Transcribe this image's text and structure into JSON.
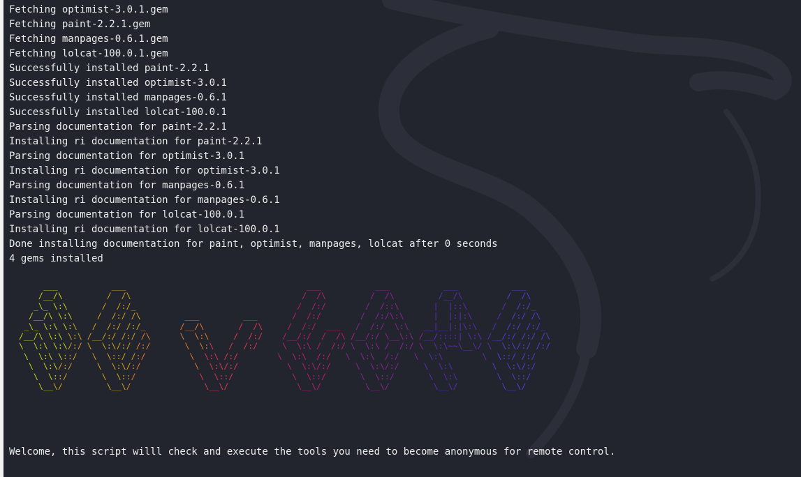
{
  "terminal": {
    "output_lines": [
      "Fetching optimist-3.0.1.gem",
      "Fetching paint-2.2.1.gem",
      "Fetching manpages-0.6.1.gem",
      "Fetching lolcat-100.0.1.gem",
      "Successfully installed paint-2.2.1",
      "Successfully installed optimist-3.0.1",
      "Successfully installed manpages-0.6.1",
      "Successfully installed lolcat-100.0.1",
      "Parsing documentation for paint-2.2.1",
      "Installing ri documentation for paint-2.2.1",
      "Parsing documentation for optimist-3.0.1",
      "Installing ri documentation for optimist-3.0.1",
      "Parsing documentation for manpages-0.6.1",
      "Installing ri documentation for manpages-0.6.1",
      "Parsing documentation for lolcat-100.0.1",
      "Installing ri documentation for lolcat-100.0.1",
      "Done installing documentation for paint, optimist, manpages, lolcat after 0 seconds",
      "4 gems installed"
    ],
    "banner_lines": [
      "       ___           ___                                     ___           ___           ___           ___",
      "      /__/\\         /  /\\                                   /  /\\         /  /\\         /__/\\         /  /\\",
      "     _\\_ \\:\\       /  /:/_                                 /  /:/        /  /::\\       |  |::\\       /  /:/_",
      "    /__/\\ \\:\\     /  /:/ /\\         ___         ___       /  /:/        /  /:/\\:\\      |  |:|:\\     /  /:/ /\\",
      "   _\\_ \\:\\ \\:\\   /  /:/ /:/_       /__/\\       /  /\\     /  /:/  ___   /  /:/  \\:\\   __|__|:|\\:\\   /  /:/ /:/_",
      "  /__/\\ \\:\\ \\:\\ /__/:/ /:/ /\\      \\  \\:\\     /  /:/    /__/:/  /  /\\ /__/:/ \\__\\:\\ /__/::::| \\:\\ /__/:/ /:/ /\\",
      "  \\  \\:\\ \\:\\/:/ \\  \\:\\/:/ /:/       \\  \\:\\   /  /:/     \\  \\:\\ /  /:/ \\  \\:\\ /  /:/ \\  \\:\\~~\\__\\/ \\  \\:\\/:/ /:/",
      "   \\  \\:\\ \\::/   \\  \\::/ /:/         \\  \\:\\ /:/        \\  \\:\\  /:/   \\  \\:\\  /:/   \\  \\:\\        \\  \\::/ /:/",
      "    \\  \\:\\/:/     \\  \\:\\/:/           \\  \\:\\/:/          \\  \\:\\/:/     \\  \\:\\/:/     \\  \\:\\        \\  \\:\\/:/",
      "     \\  \\::/       \\  \\::/             \\  \\::/            \\  \\::/       \\  \\::/       \\  \\:\\        \\  \\::/",
      "      \\__\\/         \\__\\/               \\__\\/              \\__\\/         \\__\\/         \\__\\/         \\__\\/"
    ],
    "banner_colors": [
      "#c7cf1c",
      "#d2a21d",
      "#e57a2a",
      "#e2364f",
      "#b81e74",
      "#8c2397",
      "#5b2cb8",
      "#4d40d3"
    ],
    "welcome_text": "Welcome, this script willl check and execute the tools you need to become anonymous for remote control.",
    "background_color": "#23252e",
    "text_color": "#ebebeb",
    "background_logo": "kali-dragon-icon"
  }
}
